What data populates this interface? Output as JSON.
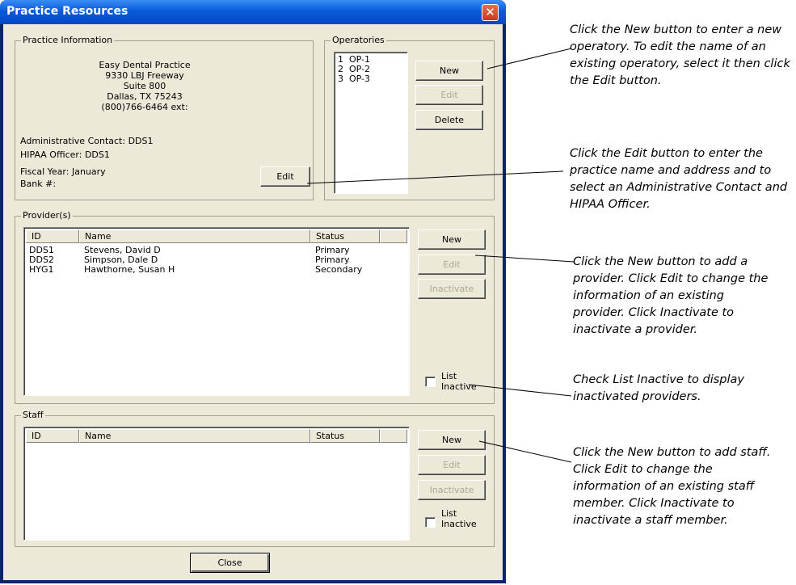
{
  "window": {
    "title": "Practice Resources",
    "close_glyph": "✕"
  },
  "practice": {
    "group_label": "Practice Information",
    "address_lines": [
      "Easy Dental Practice",
      "9330 LBJ Freeway",
      "Suite 800",
      "Dallas, TX  75243",
      "(800)766-6464 ext:"
    ],
    "admin_contact": "Administrative Contact:  DDS1",
    "hipaa_officer": "HIPAA Officer: DDS1",
    "fiscal_year": "Fiscal Year: January",
    "bank": "Bank #:",
    "edit_label": "Edit"
  },
  "operatories": {
    "group_label": "Operatories",
    "items": [
      "1  OP-1",
      "2  OP-2",
      "3  OP-3"
    ],
    "new_label": "New",
    "edit_label": "Edit",
    "delete_label": "Delete"
  },
  "providers": {
    "group_label": "Provider(s)",
    "columns": [
      "ID",
      "Name",
      "Status"
    ],
    "rows": [
      {
        "id": "DDS1",
        "name": "Stevens, David D",
        "status": "Primary"
      },
      {
        "id": "DDS2",
        "name": "Simpson, Dale D",
        "status": "Primary"
      },
      {
        "id": "HYG1",
        "name": "Hawthorne, Susan H",
        "status": "Secondary"
      }
    ],
    "new_label": "New",
    "edit_label": "Edit",
    "inactivate_label": "Inactivate",
    "list_inactive_1": "List",
    "list_inactive_2": "Inactive"
  },
  "staff": {
    "group_label": "Staff",
    "columns": [
      "ID",
      "Name",
      "Status"
    ],
    "new_label": "New",
    "edit_label": "Edit",
    "inactivate_label": "Inactivate",
    "list_inactive_1": "List",
    "list_inactive_2": "Inactive"
  },
  "close_label": "Close",
  "callouts": {
    "operatory": "Click the New button to enter a new operatory. To edit the name of an existing operatory, select it then click the Edit button.",
    "practice": "Click the Edit button to enter the practice name and address and to select an Administrative Contact and HIPAA Officer.",
    "provider": "Click the New button to add a provider. Click Edit to change the information of an existing provider. Click Inactivate to inactivate a provider.",
    "list_inactive": "Check List Inactive to display inactivated providers.",
    "staff": "Click the New button to add staff. Click Edit to change the information of an existing staff member. Click Inactivate to inactivate a staff member."
  }
}
